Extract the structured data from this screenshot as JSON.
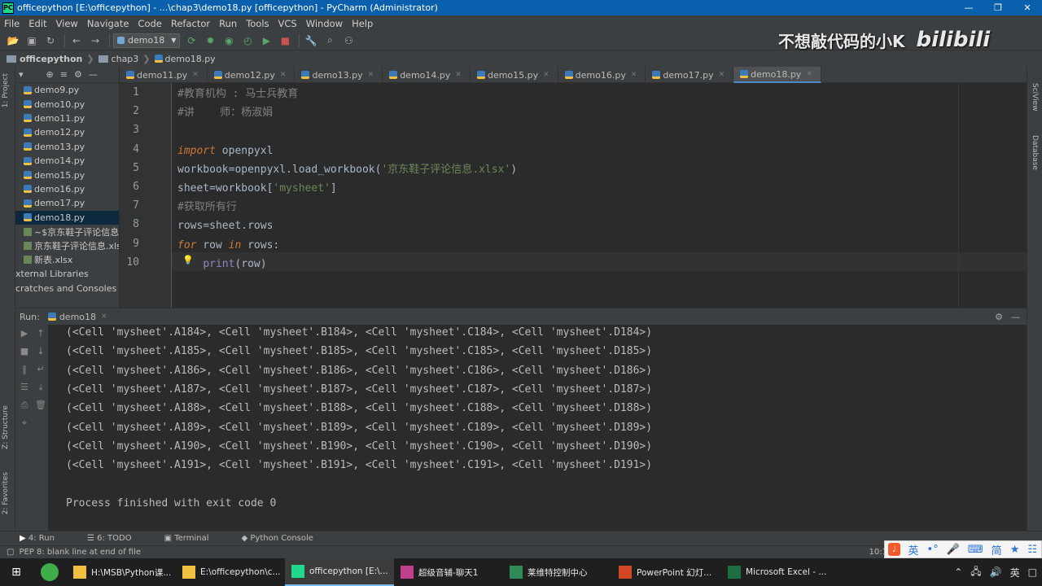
{
  "window": {
    "title": "officepython [E:\\officepython] - ...\\chap3\\demo18.py [officepython] - PyCharm (Administrator)"
  },
  "menu": [
    "File",
    "Edit",
    "View",
    "Navigate",
    "Code",
    "Refactor",
    "Run",
    "Tools",
    "VCS",
    "Window",
    "Help"
  ],
  "toolbar": {
    "run_config": "demo18"
  },
  "watermark": {
    "text": "不想敲代码的小K",
    "brand": "bilibili"
  },
  "breadcrumb": {
    "project": "officepython",
    "folder": "chap3",
    "file": "demo18.py"
  },
  "sidebar": {
    "project_tab": "1: Project",
    "structure_tab": "Z: Structure",
    "favorites_tab": "2: Favorites",
    "items": [
      {
        "label": "demo9.py",
        "type": "py"
      },
      {
        "label": "demo10.py",
        "type": "py"
      },
      {
        "label": "demo11.py",
        "type": "py"
      },
      {
        "label": "demo12.py",
        "type": "py"
      },
      {
        "label": "demo13.py",
        "type": "py"
      },
      {
        "label": "demo14.py",
        "type": "py"
      },
      {
        "label": "demo15.py",
        "type": "py"
      },
      {
        "label": "demo16.py",
        "type": "py"
      },
      {
        "label": "demo17.py",
        "type": "py"
      },
      {
        "label": "demo18.py",
        "type": "py"
      },
      {
        "label": "~$京东鞋子评论信息.xl",
        "type": "xl"
      },
      {
        "label": "京东鞋子评论信息.xlsx",
        "type": "xl"
      },
      {
        "label": "新表.xlsx",
        "type": "xl"
      },
      {
        "label": "xternal Libraries",
        "type": "root"
      },
      {
        "label": "cratches and Consoles",
        "type": "root"
      }
    ]
  },
  "right_tabs": [
    "SciView",
    "Database"
  ],
  "tabs": [
    "demo11.py",
    "demo12.py",
    "demo13.py",
    "demo14.py",
    "demo15.py",
    "demo16.py",
    "demo17.py",
    "demo18.py"
  ],
  "editor": {
    "lines": [
      {
        "n": "1",
        "text": "#教育机构 : 马士兵教育"
      },
      {
        "n": "2",
        "text": "#讲    师：杨淑娟"
      },
      {
        "n": "3",
        "text": ""
      },
      {
        "n": "4",
        "text": "import openpyxl"
      },
      {
        "n": "5",
        "text": "workbook=openpyxl.load_workbook('京东鞋子评论信息.xlsx')"
      },
      {
        "n": "6",
        "text": "sheet=workbook['mysheet']"
      },
      {
        "n": "7",
        "text": "#获取所有行"
      },
      {
        "n": "8",
        "text": "rows=sheet.rows"
      },
      {
        "n": "9",
        "text": "for row in rows:"
      },
      {
        "n": "10",
        "text": "    print(row)"
      }
    ]
  },
  "run": {
    "label": "Run:",
    "config": "demo18",
    "output": [
      "(<Cell 'mysheet'.A184>, <Cell 'mysheet'.B184>, <Cell 'mysheet'.C184>, <Cell 'mysheet'.D184>)",
      "(<Cell 'mysheet'.A185>, <Cell 'mysheet'.B185>, <Cell 'mysheet'.C185>, <Cell 'mysheet'.D185>)",
      "(<Cell 'mysheet'.A186>, <Cell 'mysheet'.B186>, <Cell 'mysheet'.C186>, <Cell 'mysheet'.D186>)",
      "(<Cell 'mysheet'.A187>, <Cell 'mysheet'.B187>, <Cell 'mysheet'.C187>, <Cell 'mysheet'.D187>)",
      "(<Cell 'mysheet'.A188>, <Cell 'mysheet'.B188>, <Cell 'mysheet'.C188>, <Cell 'mysheet'.D188>)",
      "(<Cell 'mysheet'.A189>, <Cell 'mysheet'.B189>, <Cell 'mysheet'.C189>, <Cell 'mysheet'.D189>)",
      "(<Cell 'mysheet'.A190>, <Cell 'mysheet'.B190>, <Cell 'mysheet'.C190>, <Cell 'mysheet'.D190>)",
      "(<Cell 'mysheet'.A191>, <Cell 'mysheet'.B191>, <Cell 'mysheet'.C191>, <Cell 'mysheet'.D191>)",
      "",
      "Process finished with exit code 0"
    ]
  },
  "bottom_tabs": [
    "4: Run",
    "6: TODO",
    "Terminal",
    "Python Console"
  ],
  "status": {
    "message": "PEP 8: blank line at end of file",
    "time_partial": "10:1"
  },
  "ime": {
    "lang": "英",
    "mode": "简"
  },
  "taskbar": {
    "items": [
      {
        "label": "H:\\MSB\\Python课..."
      },
      {
        "label": "E:\\officepython\\c..."
      },
      {
        "label": "officepython [E:\\..."
      },
      {
        "label": "超级音辅-聊天1"
      },
      {
        "label": "莱维特控制中心"
      },
      {
        "label": "PowerPoint 幻灯..."
      },
      {
        "label": "Microsoft Excel - ..."
      }
    ],
    "tray_lang": "英"
  }
}
